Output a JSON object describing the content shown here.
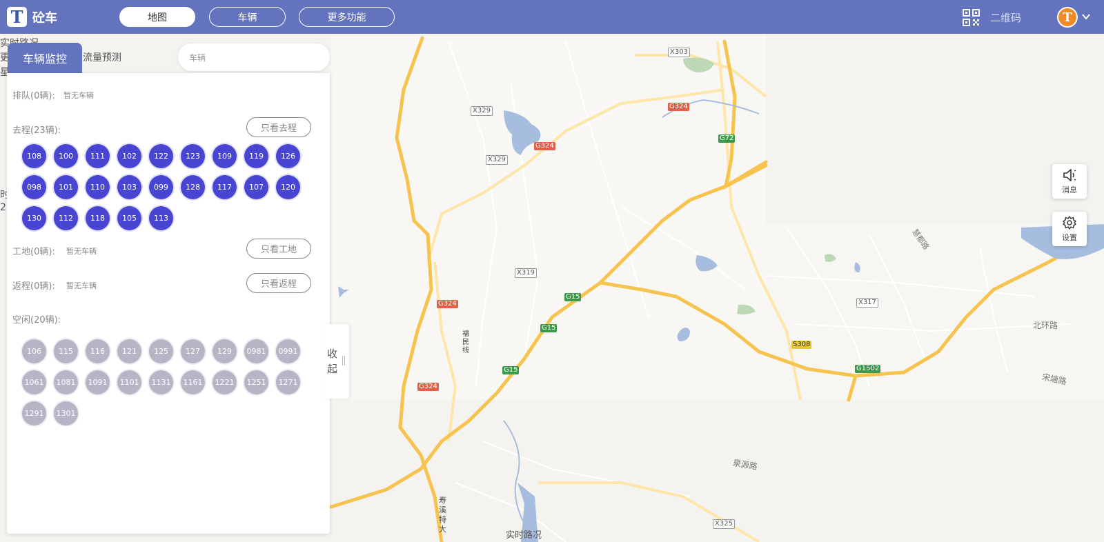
{
  "app": {
    "logo_letter": "T",
    "brand": "砼车"
  },
  "nav": {
    "items": [
      "地图",
      "车辆",
      "更多功能"
    ],
    "active": 0
  },
  "header": {
    "qr_label": "二维码",
    "avatar_letter": "T"
  },
  "ghost": {
    "line1": "实时路况",
    "line2_a": "更",
    "line2_b": "流量预测",
    "line3": "星",
    "line4": "时",
    "line5": "2"
  },
  "panel": {
    "tab_label": "车辆监控",
    "search_placeholder": "车辆",
    "queue": {
      "title": "排队(0辆):",
      "note": "暂无车辆"
    },
    "outbound": {
      "title": "去程(23辆):",
      "filter": "只看去程",
      "vehicles": [
        "108",
        "100",
        "111",
        "102",
        "122",
        "123",
        "109",
        "119",
        "126",
        "098",
        "101",
        "110",
        "103",
        "099",
        "128",
        "117",
        "107",
        "120",
        "130",
        "112",
        "118",
        "105",
        "113"
      ]
    },
    "site": {
      "title": "工地(0辆):",
      "note": "暂无车辆",
      "filter": "只看工地"
    },
    "return": {
      "title": "返程(0辆):",
      "note": "暂无车辆",
      "filter": "只看返程"
    },
    "idle": {
      "title": "空闲(20辆):",
      "vehicles": [
        "106",
        "115",
        "116",
        "121",
        "125",
        "127",
        "129",
        "0981",
        "0991",
        "1061",
        "1081",
        "1091",
        "1101",
        "1131",
        "1161",
        "1221",
        "1251",
        "1271",
        "1291",
        "1301"
      ]
    },
    "collapse_label": "收起"
  },
  "side": {
    "message": "消息",
    "settings": "设置"
  },
  "map_labels": {
    "x303": "X303",
    "x329a": "X329",
    "x329b": "X329",
    "g324a": "G324",
    "g324b": "G324",
    "g324c": "G324",
    "g324d": "G324",
    "g72": "G72",
    "x319": "X319",
    "g15a": "G15",
    "g15b": "G15",
    "g15c": "G15",
    "x317": "X317",
    "s308": "S308",
    "g1502": "G1502",
    "x325": "X325",
    "north_ring": "北环路",
    "songtang": "宋塘路",
    "quanyuan": "泉源路",
    "shouxi": "寿溪特大",
    "fumin": "福民线",
    "bottom_text": "实时路况",
    "diagonal": "慧都路"
  },
  "colors": {
    "header": "#6473bd",
    "chip_active": "#4845d2",
    "chip_idle": "#b5b5c6",
    "highway": "#f7c34f"
  }
}
